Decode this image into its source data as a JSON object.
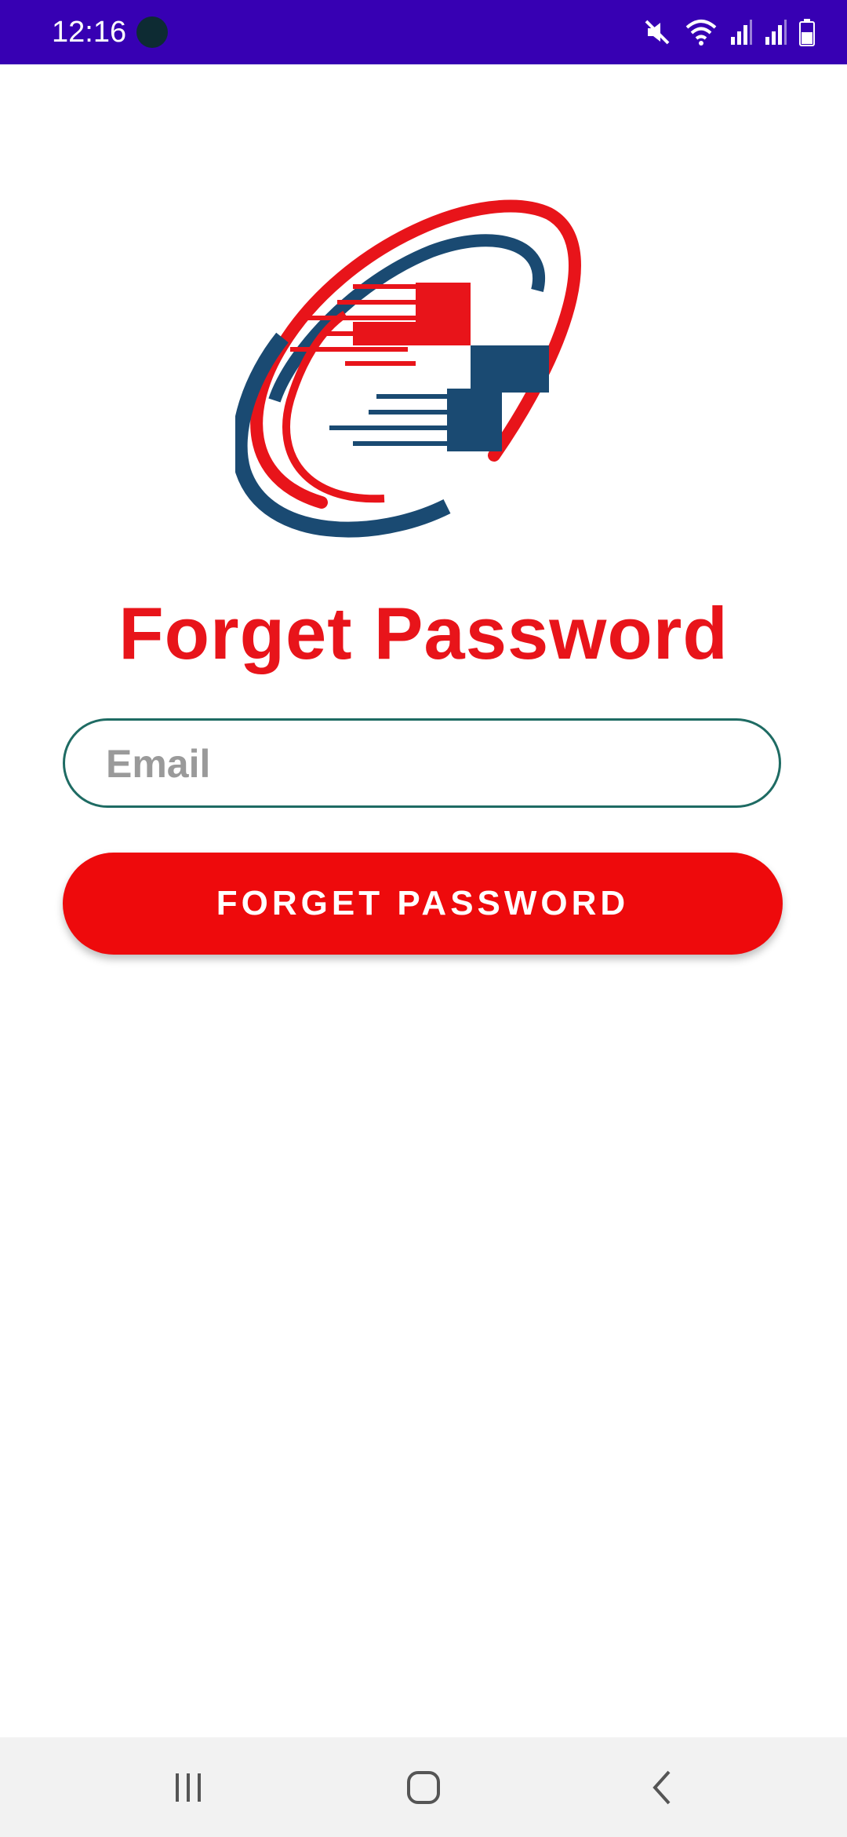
{
  "status_bar": {
    "time": "12:16",
    "icons": [
      "app-notification-icon",
      "mute-icon",
      "wifi-icon",
      "signal-icon",
      "signal-icon",
      "battery-icon"
    ],
    "background": "#3700b3"
  },
  "logo": {
    "icon": "medical-cross-logo",
    "colors": {
      "red": "#e8141a",
      "navy": "#1a4a72"
    }
  },
  "title": "Forget Password",
  "email": {
    "placeholder": "Email",
    "value": ""
  },
  "submit_button": {
    "label": "FORGET PASSWORD",
    "color": "#ee0a0c"
  },
  "nav_bar": {
    "items": [
      "recent-apps-icon",
      "home-icon",
      "back-icon"
    ]
  }
}
